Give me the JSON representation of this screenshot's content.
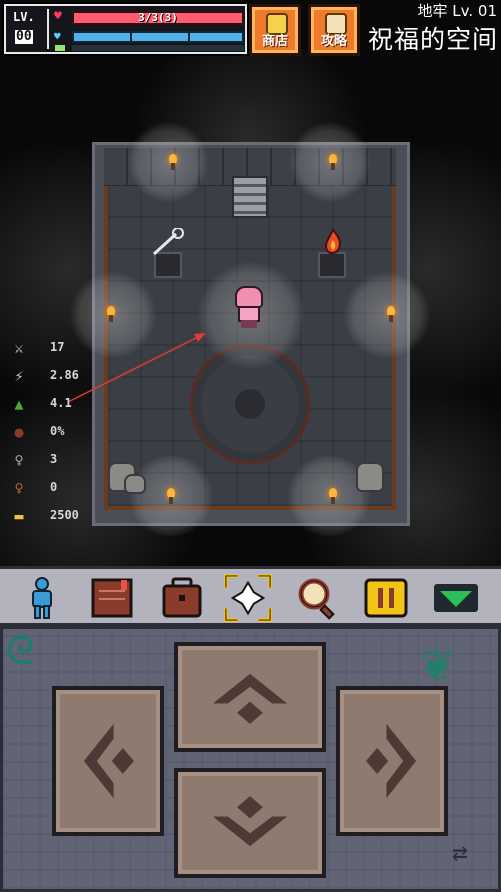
{
  "hud": {
    "level_label": "LV.",
    "level_value": "00",
    "hp_text": "3/3(3)",
    "shop_label": "商店",
    "guide_label": "攻略"
  },
  "location": {
    "dungeon": "地牢 Lv. 01",
    "room": "祝福的空间"
  },
  "stats": [
    {
      "icon": "attack-icon",
      "value": "17"
    },
    {
      "icon": "attack-speed-icon",
      "value": "2.86"
    },
    {
      "icon": "speed-icon",
      "value": "4.1"
    },
    {
      "icon": "crit-icon",
      "value": "0%"
    },
    {
      "icon": "silver-key-icon",
      "value": "3"
    },
    {
      "icon": "bronze-key-icon",
      "value": "0"
    },
    {
      "icon": "gold-icon",
      "value": "2500"
    }
  ],
  "toolbar": [
    "character-icon",
    "journal-icon",
    "backpack-icon",
    "target-icon",
    "magnifier-icon",
    "pause-icon",
    "collapse-icon"
  ],
  "colors": {
    "hp": "#ff5a6e",
    "mp": "#4fb2ea",
    "accent": "#f07a2c",
    "toolbar_bg": "#b2b3bd",
    "pad_bg": "#616475",
    "dpad": "#8e7a6f"
  }
}
